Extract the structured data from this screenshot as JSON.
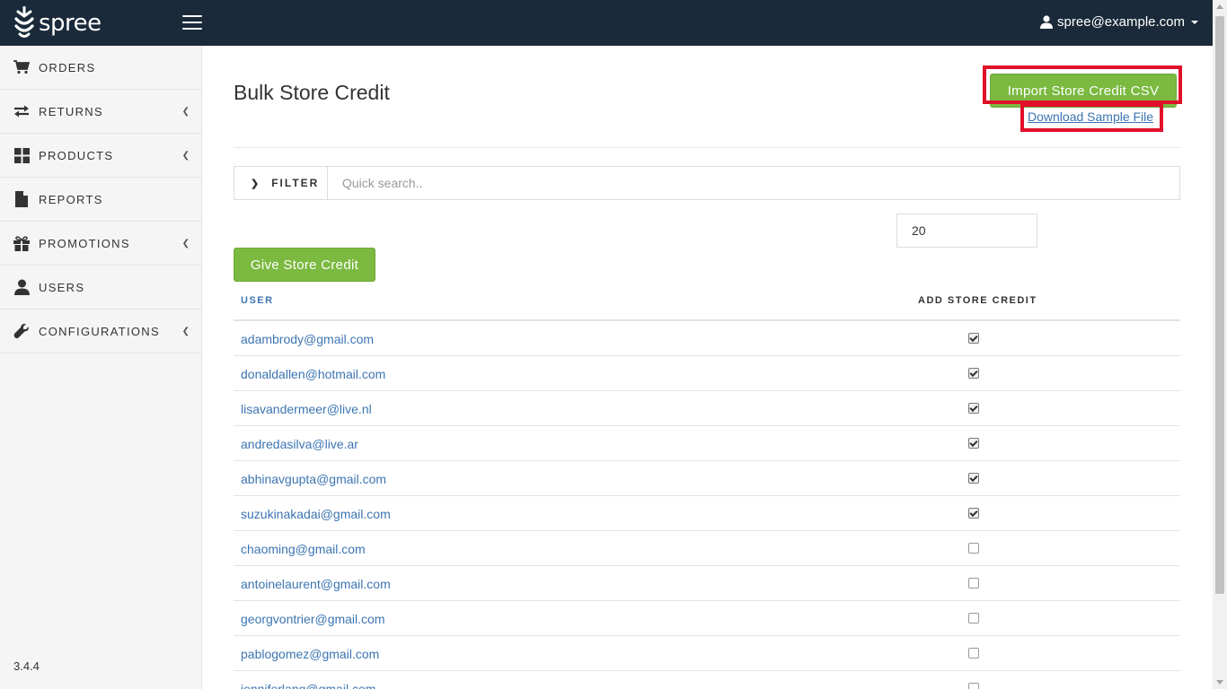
{
  "header": {
    "logo_text": "spree",
    "user_email": "spree@example.com"
  },
  "sidebar": {
    "items": [
      {
        "label": "ORDERS",
        "icon": "cart-icon",
        "has_submenu": false
      },
      {
        "label": "RETURNS",
        "icon": "exchange-icon",
        "has_submenu": true
      },
      {
        "label": "PRODUCTS",
        "icon": "grid-icon",
        "has_submenu": true
      },
      {
        "label": "REPORTS",
        "icon": "file-icon",
        "has_submenu": false
      },
      {
        "label": "PROMOTIONS",
        "icon": "gift-icon",
        "has_submenu": true
      },
      {
        "label": "USERS",
        "icon": "user-icon",
        "has_submenu": false
      },
      {
        "label": "CONFIGURATIONS",
        "icon": "wrench-icon",
        "has_submenu": true
      }
    ],
    "version": "3.4.4"
  },
  "main": {
    "title": "Bulk Store Credit",
    "import_button": "Import Store Credit CSV",
    "download_link": "Download Sample File",
    "filter": {
      "label": "FILTER",
      "placeholder": "Quick search.."
    },
    "amount_value": "20",
    "give_button": "Give Store Credit",
    "table": {
      "col_user": "USER",
      "col_credit": "ADD STORE CREDIT",
      "rows": [
        {
          "email": "adambrody@gmail.com",
          "checked": true
        },
        {
          "email": "donaldallen@hotmail.com",
          "checked": true
        },
        {
          "email": "lisavandermeer@live.nl",
          "checked": true
        },
        {
          "email": "andredasilva@live.ar",
          "checked": true
        },
        {
          "email": "abhinavgupta@gmail.com",
          "checked": true
        },
        {
          "email": "suzukinakadai@gmail.com",
          "checked": true
        },
        {
          "email": "chaoming@gmail.com",
          "checked": false
        },
        {
          "email": "antoinelaurent@gmail.com",
          "checked": false
        },
        {
          "email": "georgvontrier@gmail.com",
          "checked": false
        },
        {
          "email": "pablogomez@gmail.com",
          "checked": false
        },
        {
          "email": "jenniferlang@gmail.com",
          "checked": false
        }
      ]
    }
  },
  "colors": {
    "header_bg": "#1a2a3a",
    "accent_green": "#7bb940",
    "link_blue": "#3c75b2",
    "highlight_red": "#e0102a"
  }
}
